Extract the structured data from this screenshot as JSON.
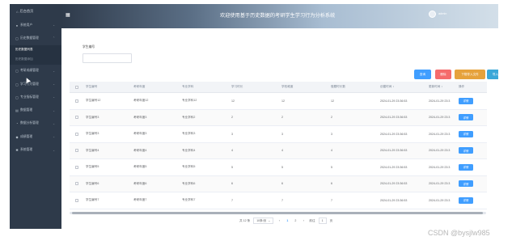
{
  "sidebar": {
    "home_label": "后台首页",
    "home_icon": "home-icon",
    "items": [
      {
        "label": "系统用户",
        "icon": "user-icon"
      },
      {
        "label": "历史数据管理",
        "icon": "doc-icon"
      }
    ],
    "subitems": [
      {
        "label": "历史数据列表",
        "active": true
      },
      {
        "label": "历史数据添加",
        "active": false
      }
    ],
    "items_after": [
      {
        "label": "考研成绩管理",
        "icon": "doc-icon"
      },
      {
        "label": "学习行为管理",
        "icon": "doc-icon"
      },
      {
        "label": "专业指标管理",
        "icon": "doc-icon"
      },
      {
        "label": "数据管理",
        "icon": "grid-icon"
      },
      {
        "label": "数据分析管理",
        "icon": "chart-icon"
      },
      {
        "label": "成绩管理",
        "icon": "pin-icon"
      },
      {
        "label": "系统管理",
        "icon": "gear-icon"
      }
    ]
  },
  "header": {
    "title": "欢迎使用基于历史数据的考研学生学习行为分析系统",
    "user": "admin"
  },
  "filter": {
    "label": "学生编号",
    "value": "",
    "placeholder": ""
  },
  "buttons": {
    "search": "查询",
    "delete": "删除",
    "export": "下载导入文件",
    "import": "导入"
  },
  "table": {
    "headers": [
      "学生编号",
      "考研年度",
      "专业学科",
      "学习时长",
      "学校难度",
      "做题时长数",
      "创建时间 ↕",
      "更新时间 ↕",
      "操作"
    ],
    "rows": [
      [
        "学生编号12",
        "考研年度12",
        "专业学科12",
        "12",
        "12",
        "12",
        "2024-01-29 23:36:53",
        "2024-01-29 23:3",
        "详情"
      ],
      [
        "学生编号3",
        "考研年度3",
        "专业学科2",
        "2",
        "2",
        "2",
        "2024-01-29 23:36:53",
        "2024-01-29 23:3",
        "详情"
      ],
      [
        "学生编号3",
        "考研年度3",
        "专业学科3",
        "3",
        "3",
        "3",
        "2024-01-29 23:36:53",
        "2024-01-29 23:3",
        "详情"
      ],
      [
        "学生编号4",
        "考研年度4",
        "专业学科4",
        "4",
        "4",
        "4",
        "2024-01-29 23:36:53",
        "2024-01-29 23:3",
        "详情"
      ],
      [
        "学生编号5",
        "考研年度5",
        "专业学科5",
        "5",
        "5",
        "5",
        "2024-01-29 23:36:53",
        "2024-01-29 23:3",
        "详情"
      ],
      [
        "学生编号6",
        "考研年度6",
        "专业学科6",
        "6",
        "6",
        "6",
        "2024-01-29 23:36:53",
        "2024-01-29 23:3",
        "详情"
      ],
      [
        "学生编号7",
        "考研年度7",
        "专业学科7",
        "7",
        "7",
        "7",
        "2024-01-29 23:36:53",
        "2024-01-29 23:3",
        "详情"
      ]
    ]
  },
  "pagination": {
    "total": "共 12 条",
    "page_size": "10条/页",
    "prev": "‹",
    "pages": [
      "1",
      "2"
    ],
    "current": "1",
    "next": "›",
    "goto_label": "前往",
    "goto_value": "1",
    "goto_suffix": "页"
  },
  "watermark": "CSDN @bysjlw985",
  "colors": {
    "sidebar": "#2e3a4a",
    "primary": "#409eff",
    "danger": "#f56c6c",
    "warning": "#e6a23c",
    "info": "#3aa7d8"
  }
}
